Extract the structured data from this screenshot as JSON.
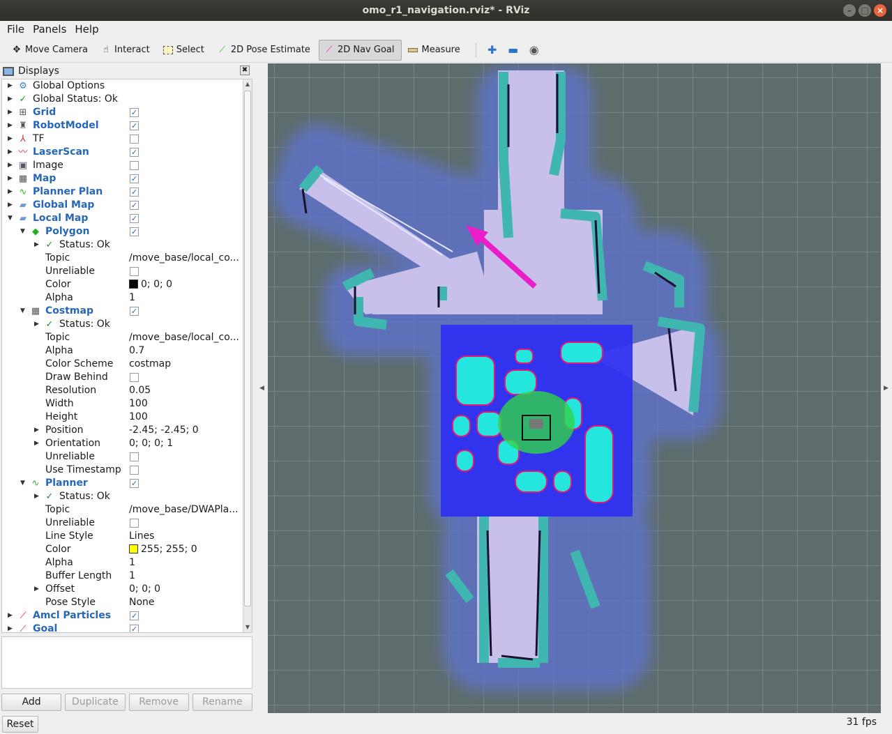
{
  "window": {
    "title": "omo_r1_navigation.rviz* - RViz"
  },
  "menu": [
    "File",
    "Panels",
    "Help"
  ],
  "toolbar": {
    "tools": [
      {
        "label": "Move Camera",
        "icon": "move-camera-icon",
        "active": false
      },
      {
        "label": "Interact",
        "icon": "hand-icon",
        "active": false
      },
      {
        "label": "Select",
        "icon": "select-box-icon",
        "active": false
      },
      {
        "label": "2D Pose Estimate",
        "icon": "green-arrow-icon",
        "active": false
      },
      {
        "label": "2D Nav Goal",
        "icon": "magenta-arrow-icon",
        "active": true
      },
      {
        "label": "Measure",
        "icon": "ruler-icon",
        "active": false
      }
    ]
  },
  "displays": {
    "title": "Displays",
    "rows": [
      {
        "label": "Global Options"
      },
      {
        "label": "Global Status: Ok"
      },
      {
        "label": "Grid"
      },
      {
        "label": "RobotModel"
      },
      {
        "label": "TF"
      },
      {
        "label": "LaserScan"
      },
      {
        "label": "Image"
      },
      {
        "label": "Map"
      },
      {
        "label": "Planner Plan"
      },
      {
        "label": "Global Map"
      },
      {
        "label": "Local Map"
      },
      {
        "label": "Polygon"
      },
      {
        "label": "Status: Ok"
      },
      {
        "label": "Topic",
        "value": "/move_base/local_co..."
      },
      {
        "label": "Unreliable"
      },
      {
        "label": "Color",
        "value": "0; 0; 0"
      },
      {
        "label": "Alpha",
        "value": "1"
      },
      {
        "label": "Costmap"
      },
      {
        "label": "Status: Ok"
      },
      {
        "label": "Topic",
        "value": "/move_base/local_co..."
      },
      {
        "label": "Alpha",
        "value": "0.7"
      },
      {
        "label": "Color Scheme",
        "value": "costmap"
      },
      {
        "label": "Draw Behind"
      },
      {
        "label": "Resolution",
        "value": "0.05"
      },
      {
        "label": "Width",
        "value": "100"
      },
      {
        "label": "Height",
        "value": "100"
      },
      {
        "label": "Position",
        "value": "-2.45; -2.45; 0"
      },
      {
        "label": "Orientation",
        "value": "0; 0; 0; 1"
      },
      {
        "label": "Unreliable"
      },
      {
        "label": "Use Timestamp"
      },
      {
        "label": "Planner"
      },
      {
        "label": "Status: Ok"
      },
      {
        "label": "Topic",
        "value": "/move_base/DWAPla..."
      },
      {
        "label": "Unreliable"
      },
      {
        "label": "Line Style",
        "value": "Lines"
      },
      {
        "label": "Color",
        "value": "255; 255; 0"
      },
      {
        "label": "Alpha",
        "value": "1"
      },
      {
        "label": "Buffer Length",
        "value": "1"
      },
      {
        "label": "Offset",
        "value": "0; 0; 0"
      },
      {
        "label": "Pose Style",
        "value": "None"
      },
      {
        "label": "Amcl Particles"
      },
      {
        "label": "Goal"
      }
    ],
    "buttons": {
      "add": "Add",
      "duplicate": "Duplicate",
      "remove": "Remove",
      "rename": "Rename"
    }
  },
  "status": {
    "reset": "Reset",
    "fps": "31 fps"
  },
  "colors": {
    "accent": "#2767b8",
    "viewport_bg": "#5e6c6c",
    "nav_goal_arrow": "#e91ec8",
    "costmap_blue": "#2d2df0",
    "inflation_cyan": "#22e8e0"
  }
}
